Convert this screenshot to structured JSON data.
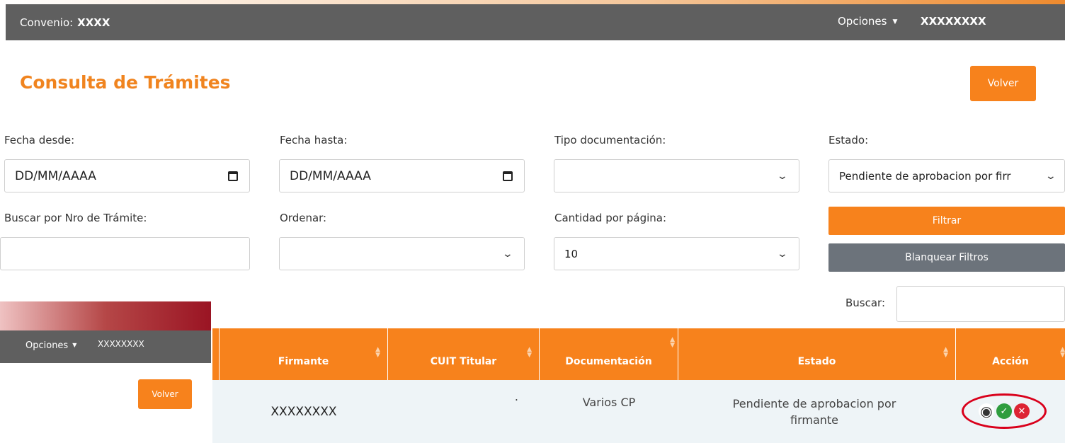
{
  "header": {
    "convenio_label": "Convenio:",
    "convenio_value": "XXXX",
    "opciones_label": "Opciones",
    "user_name": "XXXXXXXX"
  },
  "page": {
    "title": "Consulta de Trámites",
    "volver_label": "Volver"
  },
  "filters": {
    "fecha_desde": {
      "label": "Fecha desde:",
      "value": "DD/MM/AAAA"
    },
    "fecha_hasta": {
      "label": "Fecha hasta:",
      "value": "DD/MM/AAAA"
    },
    "tipo_documentacion": {
      "label": "Tipo documentación:",
      "value": ""
    },
    "estado": {
      "label": "Estado:",
      "value": "Pendiente de aprobacion por firr"
    },
    "nro_tramite": {
      "label": "Buscar por Nro de Trámite:",
      "value": ""
    },
    "ordenar": {
      "label": "Ordenar:",
      "value": ""
    },
    "cantidad": {
      "label": "Cantidad por página:",
      "value": "10"
    },
    "filtrar_label": "Filtrar",
    "blanquear_label": "Blanquear Filtros"
  },
  "search": {
    "label": "Buscar:",
    "value": ""
  },
  "table": {
    "columns": [
      "Firmante",
      "CUIT Titular",
      "Documentación",
      "Estado",
      "Acción"
    ],
    "rows": [
      {
        "firmante": "XXXXXXXX",
        "cuit": ".",
        "documentacion": "Varios CP",
        "estado": "Pendiente de aprobacion por firmante"
      }
    ]
  },
  "inset": {
    "opciones_label": "Opciones",
    "user_name": "XXXXXXXX",
    "volver_label": "Volver"
  },
  "colors": {
    "accent": "#f7821c",
    "header": "#5f5f5f",
    "secondary_button": "#6c737b",
    "approve": "#2e9d3e",
    "reject": "#dd2433",
    "highlight_circle": "#d9001b"
  }
}
